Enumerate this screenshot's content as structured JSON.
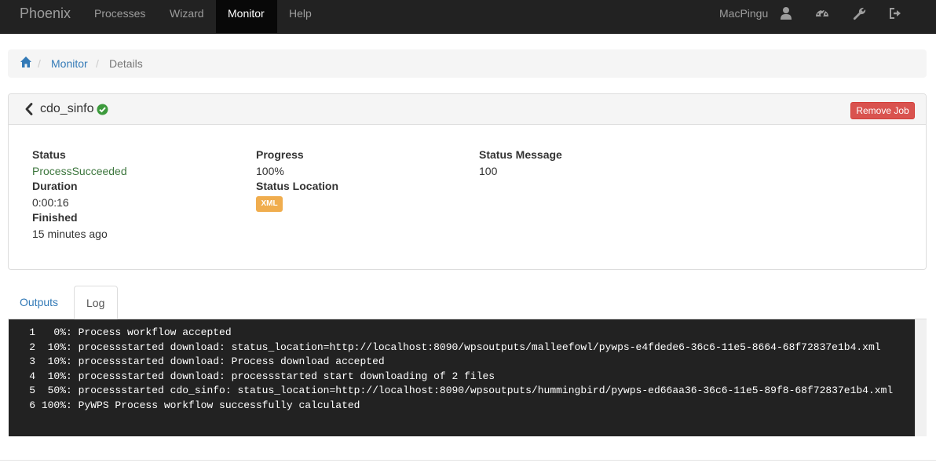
{
  "navbar": {
    "brand": "Phoenix",
    "items": [
      {
        "label": "Processes"
      },
      {
        "label": "Wizard"
      },
      {
        "label": "Monitor"
      },
      {
        "label": "Help"
      }
    ],
    "user": "MacPingu",
    "icons": [
      "user-icon",
      "dashboard-icon",
      "wrench-icon",
      "sign-out-icon"
    ]
  },
  "breadcrumb": {
    "home_icon": "home-icon",
    "items": [
      "Monitor",
      "Details"
    ],
    "separator": "/"
  },
  "job": {
    "title": "cdo_sinfo",
    "status_icon": "check-circle-icon",
    "remove_label": "Remove Job",
    "fields": {
      "status_label": "Status",
      "status_value": "ProcessSucceeded",
      "duration_label": "Duration",
      "duration_value": "0:00:16",
      "finished_label": "Finished",
      "finished_value": "15 minutes ago",
      "progress_label": "Progress",
      "progress_value": "100%",
      "status_location_label": "Status Location",
      "status_location_badge": "XML",
      "status_message_label": "Status Message",
      "status_message_value": "100"
    }
  },
  "tabs": [
    {
      "label": "Outputs",
      "active": false
    },
    {
      "label": "Log",
      "active": true
    }
  ],
  "log": [
    {
      "num": "1",
      "text": "  0%: Process workflow accepted"
    },
    {
      "num": "2",
      "text": " 10%: processstarted download: status_location=http://localhost:8090/wpsoutputs/malleefowl/pywps-e4fdede6-36c6-11e5-8664-68f72837e1b4.xml"
    },
    {
      "num": "3",
      "text": " 10%: processstarted download: Process download accepted"
    },
    {
      "num": "4",
      "text": " 10%: processstarted download: processstarted start downloading of 2 files"
    },
    {
      "num": "5",
      "text": " 50%: processstarted cdo_sinfo: status_location=http://localhost:8090/wpsoutputs/hummingbird/pywps-ed66aa36-36c6-11e5-89f8-68f72837e1b4.xml"
    },
    {
      "num": "6",
      "text": "100%: PyWPS Process workflow successfully calculated"
    }
  ],
  "colors": {
    "navbar_bg": "#222222",
    "link": "#337ab7",
    "success": "#3c763d",
    "danger": "#d9534f",
    "warning": "#f0ad4e"
  }
}
